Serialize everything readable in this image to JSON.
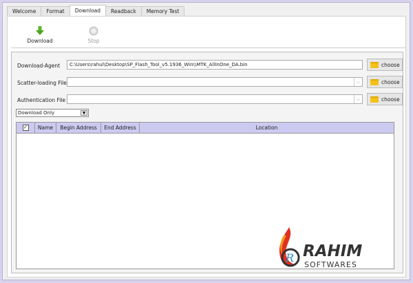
{
  "tabs": [
    "Welcome",
    "Format",
    "Download",
    "Readback",
    "Memory Test"
  ],
  "toolbar": {
    "download": "Download",
    "stop": "Stop"
  },
  "fields": [
    {
      "label": "Download-Agent",
      "value": "C:\\Users\\rahul\\Desktop\\SP_Flash_Tool_v5.1936_Win\\\\MTK_AllInOne_DA.bin",
      "button": "choose"
    },
    {
      "label": "Scatter-loading File",
      "value": "",
      "button": "choose"
    },
    {
      "label": "Authentication File",
      "value": "",
      "button": "choose"
    }
  ],
  "mode": {
    "selected": "Download Only"
  },
  "table": {
    "columns": [
      "Name",
      "Begin Address",
      "End Address",
      "Location"
    ]
  },
  "watermark": {
    "brand": "RAHIM",
    "sub": "SOFTWARES"
  }
}
